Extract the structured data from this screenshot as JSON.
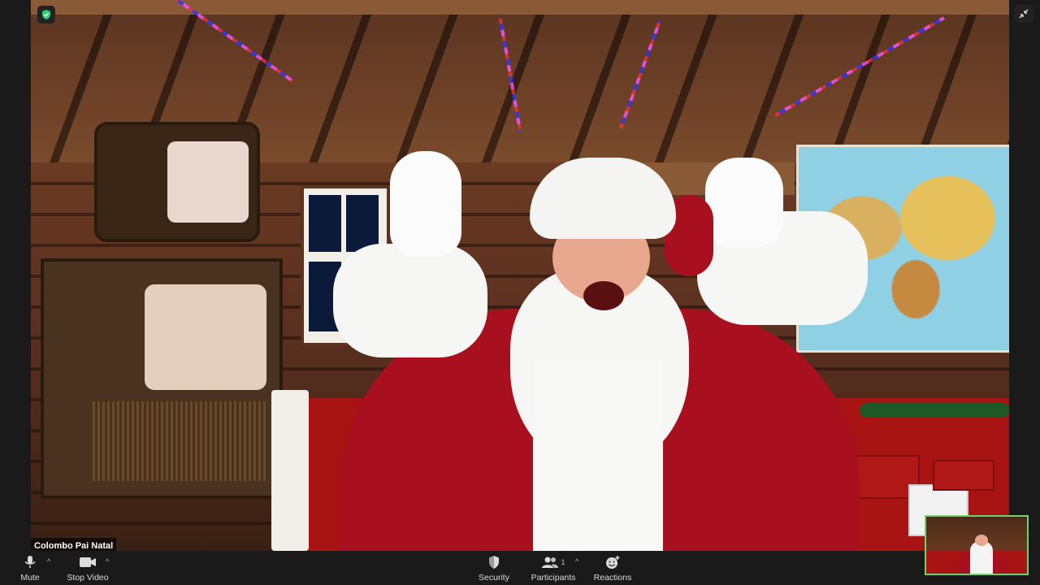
{
  "meeting": {
    "participant_name": "Colombo Pai Natal",
    "participant_count": "1"
  },
  "toolbar": {
    "mute_label": "Mute",
    "stop_video_label": "Stop Video",
    "security_label": "Security",
    "participants_label": "Participants",
    "reactions_label": "Reactions"
  },
  "colors": {
    "toolbar_bg": "#1a1a1a",
    "security_shield": "#2ecc71",
    "active_speaker_border": "#6fd26f"
  },
  "icons": {
    "encryption": "shield-check-icon",
    "exit_fullscreen": "minimize-icon",
    "mute": "microphone-icon",
    "video": "video-camera-icon",
    "security": "shield-icon",
    "participants": "people-icon",
    "reactions": "smiley-plus-icon"
  }
}
